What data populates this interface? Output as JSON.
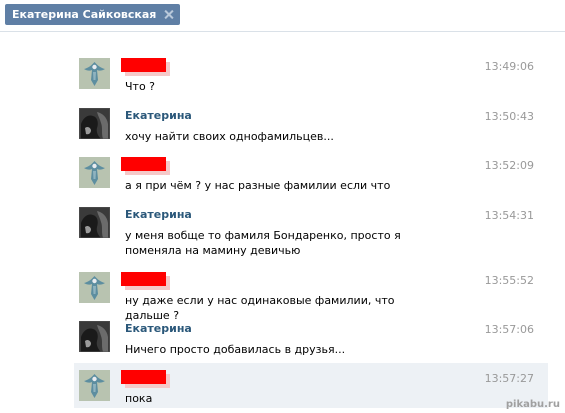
{
  "tab": {
    "title": "Екатерина Сайковская"
  },
  "messages": [
    {
      "author": "",
      "redacted": true,
      "avatar": "bird-avatar",
      "time": "13:49:06",
      "text": "Что ?"
    },
    {
      "author": "Екатерина",
      "redacted": false,
      "avatar": "photo-avatar",
      "time": "13:50:43",
      "text": "хочу найти своих однофамильцев..."
    },
    {
      "author": "",
      "redacted": true,
      "avatar": "bird-avatar",
      "time": "13:52:09",
      "text": "а я при чём ? у нас разные фамилии если что"
    },
    {
      "author": "Екатерина",
      "redacted": false,
      "avatar": "photo-avatar",
      "time": "13:54:31",
      "text": "у меня вобще то фамиля Бондаренко, просто я поменяла на мамину девичью"
    },
    {
      "author": "",
      "redacted": true,
      "avatar": "bird-avatar",
      "time": "13:55:52",
      "text": "ну даже если у нас одинаковые фамилии, что дальше ?"
    },
    {
      "author": "Екатерина",
      "redacted": false,
      "avatar": "photo-avatar",
      "time": "13:57:06",
      "text": "Ничего просто добавилась в друзья..."
    },
    {
      "author": "",
      "redacted": true,
      "avatar": "bird-avatar",
      "time": "13:57:27",
      "text": "пока",
      "highlighted": true
    }
  ],
  "watermark": "pikabu.ru",
  "colors": {
    "tab": "#5f7fa5",
    "author": "#2b587a",
    "time": "#999999",
    "redaction": "#ff0000",
    "highlight": "#edf1f5"
  }
}
